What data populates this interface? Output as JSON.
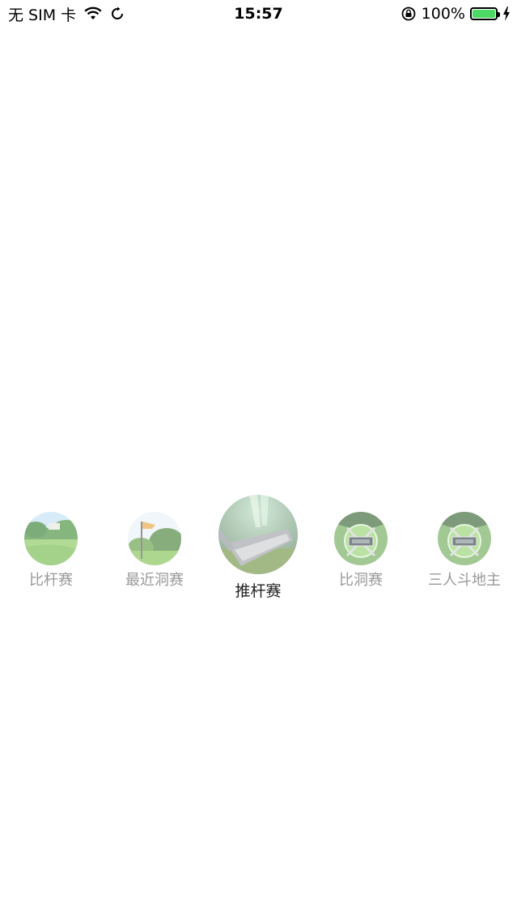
{
  "status_bar": {
    "carrier": "无 SIM 卡",
    "time": "15:57",
    "battery_percent": "100%",
    "battery_level": 1.0,
    "battery_color": "#4cd964"
  },
  "modes": {
    "selected_index": 2,
    "items": [
      {
        "label": "比杆赛",
        "image": "golf-course-icon"
      },
      {
        "label": "最近洞赛",
        "image": "golf-flag-icon"
      },
      {
        "label": "推杆赛",
        "image": "golf-club-icon"
      },
      {
        "label": "比洞赛",
        "image": "strike-badge-icon"
      },
      {
        "label": "三人斗地主",
        "image": "strike-badge-icon"
      }
    ]
  }
}
